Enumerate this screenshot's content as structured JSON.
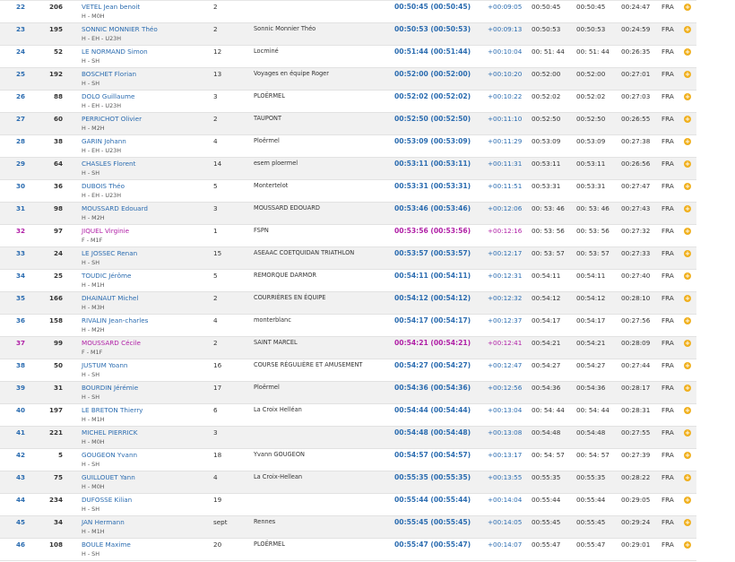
{
  "results": [
    {
      "rank": "22",
      "bib": "206",
      "name": "VETEL Jean benoit",
      "category": "H - M0H",
      "laps": "2",
      "club": "",
      "time": "00:50:45 (00:50:45)",
      "gap": "+00:09:05",
      "t1": "00:50:45",
      "t2": "00:50:45",
      "t3": "00:24:47",
      "nat": "FRA",
      "female": false
    },
    {
      "rank": "23",
      "bib": "195",
      "name": "SONNIC MONNIER Théo",
      "category": "H - EH - U23H",
      "laps": "2",
      "club": "Sonnic Monnier Théo",
      "time": "00:50:53 (00:50:53)",
      "gap": "+00:09:13",
      "t1": "00:50:53",
      "t2": "00:50:53",
      "t3": "00:24:59",
      "nat": "FRA",
      "female": false
    },
    {
      "rank": "24",
      "bib": "52",
      "name": "LE NORMAND Simon",
      "category": "H - SH",
      "laps": "12",
      "club": "Locminé",
      "time": "00:51:44 (00:51:44)",
      "gap": "+00:10:04",
      "t1": "00: 51: 44",
      "t2": "00: 51: 44",
      "t3": "00:26:35",
      "nat": "FRA",
      "female": false
    },
    {
      "rank": "25",
      "bib": "192",
      "name": "BOSCHET Florian",
      "category": "H - SH",
      "laps": "13",
      "club": "Voyages en équipe Roger",
      "time": "00:52:00 (00:52:00)",
      "gap": "+00:10:20",
      "t1": "00:52:00",
      "t2": "00:52:00",
      "t3": "00:27:01",
      "nat": "FRA",
      "female": false
    },
    {
      "rank": "26",
      "bib": "88",
      "name": "DOLO Guillaume",
      "category": "H - EH - U23H",
      "laps": "3",
      "club": "PLOËRMEL",
      "time": "00:52:02 (00:52:02)",
      "gap": "+00:10:22",
      "t1": "00:52:02",
      "t2": "00:52:02",
      "t3": "00:27:03",
      "nat": "FRA",
      "female": false
    },
    {
      "rank": "27",
      "bib": "60",
      "name": "PERRICHOT Olivier",
      "category": "H - M2H",
      "laps": "2",
      "club": "TAUPONT",
      "time": "00:52:50 (00:52:50)",
      "gap": "+00:11:10",
      "t1": "00:52:50",
      "t2": "00:52:50",
      "t3": "00:26:55",
      "nat": "FRA",
      "female": false
    },
    {
      "rank": "28",
      "bib": "38",
      "name": "GARIN Johann",
      "category": "H - EH - U23H",
      "laps": "4",
      "club": "Ploërmel",
      "time": "00:53:09 (00:53:09)",
      "gap": "+00:11:29",
      "t1": "00:53:09",
      "t2": "00:53:09",
      "t3": "00:27:38",
      "nat": "FRA",
      "female": false
    },
    {
      "rank": "29",
      "bib": "64",
      "name": "CHASLES Florent",
      "category": "H - SH",
      "laps": "14",
      "club": "esem ploermel",
      "time": "00:53:11 (00:53:11)",
      "gap": "+00:11:31",
      "t1": "00:53:11",
      "t2": "00:53:11",
      "t3": "00:26:56",
      "nat": "FRA",
      "female": false
    },
    {
      "rank": "30",
      "bib": "36",
      "name": "DUBOIS Théo",
      "category": "H - EH - U23H",
      "laps": "5",
      "club": "Montertelot",
      "time": "00:53:31 (00:53:31)",
      "gap": "+00:11:51",
      "t1": "00:53:31",
      "t2": "00:53:31",
      "t3": "00:27:47",
      "nat": "FRA",
      "female": false
    },
    {
      "rank": "31",
      "bib": "98",
      "name": "MOUSSARD Edouard",
      "category": "H - M2H",
      "laps": "3",
      "club": "MOUSSARD EDOUARD",
      "time": "00:53:46 (00:53:46)",
      "gap": "+00:12:06",
      "t1": "00: 53: 46",
      "t2": "00: 53: 46",
      "t3": "00:27:43",
      "nat": "FRA",
      "female": false
    },
    {
      "rank": "32",
      "bib": "97",
      "name": "JIQUEL Virginie",
      "category": "F - M1F",
      "laps": "1",
      "club": "FSPN",
      "time": "00:53:56 (00:53:56)",
      "gap": "+00:12:16",
      "t1": "00: 53: 56",
      "t2": "00: 53: 56",
      "t3": "00:27:32",
      "nat": "FRA",
      "female": true
    },
    {
      "rank": "33",
      "bib": "24",
      "name": "LE JOSSEC Renan",
      "category": "H - SH",
      "laps": "15",
      "club": "ASEAAC COETQUIDAN TRIATHLON",
      "time": "00:53:57 (00:53:57)",
      "gap": "+00:12:17",
      "t1": "00: 53: 57",
      "t2": "00: 53: 57",
      "t3": "00:27:33",
      "nat": "FRA",
      "female": false
    },
    {
      "rank": "34",
      "bib": "25",
      "name": "TOUDIC Jérôme",
      "category": "H - M1H",
      "laps": "5",
      "club": "REMORQUE DARMOR",
      "time": "00:54:11 (00:54:11)",
      "gap": "+00:12:31",
      "t1": "00:54:11",
      "t2": "00:54:11",
      "t3": "00:27:40",
      "nat": "FRA",
      "female": false
    },
    {
      "rank": "35",
      "bib": "166",
      "name": "DHAINAUT Michel",
      "category": "H - M3H",
      "laps": "2",
      "club": "COURRIÈRES EN ÉQUIPE",
      "time": "00:54:12 (00:54:12)",
      "gap": "+00:12:32",
      "t1": "00:54:12",
      "t2": "00:54:12",
      "t3": "00:28:10",
      "nat": "FRA",
      "female": false
    },
    {
      "rank": "36",
      "bib": "158",
      "name": "RIVALIN Jean-charles",
      "category": "H - M2H",
      "laps": "4",
      "club": "monterblanc",
      "time": "00:54:17 (00:54:17)",
      "gap": "+00:12:37",
      "t1": "00:54:17",
      "t2": "00:54:17",
      "t3": "00:27:56",
      "nat": "FRA",
      "female": false
    },
    {
      "rank": "37",
      "bib": "99",
      "name": "MOUSSARD Cécile",
      "category": "F - M1F",
      "laps": "2",
      "club": "SAINT MARCEL",
      "time": "00:54:21 (00:54:21)",
      "gap": "+00:12:41",
      "t1": "00:54:21",
      "t2": "00:54:21",
      "t3": "00:28:09",
      "nat": "FRA",
      "female": true
    },
    {
      "rank": "38",
      "bib": "50",
      "name": "JUSTUM Yoann",
      "category": "H - SH",
      "laps": "16",
      "club": "COURSE RÉGULIÈRE ET AMUSEMENT",
      "time": "00:54:27 (00:54:27)",
      "gap": "+00:12:47",
      "t1": "00:54:27",
      "t2": "00:54:27",
      "t3": "00:27:44",
      "nat": "FRA",
      "female": false
    },
    {
      "rank": "39",
      "bib": "31",
      "name": "BOURDIN Jérémie",
      "category": "H - SH",
      "laps": "17",
      "club": "Ploërmel",
      "time": "00:54:36 (00:54:36)",
      "gap": "+00:12:56",
      "t1": "00:54:36",
      "t2": "00:54:36",
      "t3": "00:28:17",
      "nat": "FRA",
      "female": false
    },
    {
      "rank": "40",
      "bib": "197",
      "name": "LE BRETON Thierry",
      "category": "H - M1H",
      "laps": "6",
      "club": "La Croix Helléan",
      "time": "00:54:44 (00:54:44)",
      "gap": "+00:13:04",
      "t1": "00: 54: 44",
      "t2": "00: 54: 44",
      "t3": "00:28:31",
      "nat": "FRA",
      "female": false
    },
    {
      "rank": "41",
      "bib": "221",
      "name": "MICHEL PIERRICK",
      "category": "H - M0H",
      "laps": "3",
      "club": "",
      "time": "00:54:48 (00:54:48)",
      "gap": "+00:13:08",
      "t1": "00:54:48",
      "t2": "00:54:48",
      "t3": "00:27:55",
      "nat": "FRA",
      "female": false
    },
    {
      "rank": "42",
      "bib": "5",
      "name": "GOUGEON Yvann",
      "category": "H - SH",
      "laps": "18",
      "club": "Yvann GOUGEON",
      "time": "00:54:57 (00:54:57)",
      "gap": "+00:13:17",
      "t1": "00: 54: 57",
      "t2": "00: 54: 57",
      "t3": "00:27:39",
      "nat": "FRA",
      "female": false
    },
    {
      "rank": "43",
      "bib": "75",
      "name": "GUILLOUET Yann",
      "category": "H - M0H",
      "laps": "4",
      "club": "La Croix-Hellean",
      "time": "00:55:35 (00:55:35)",
      "gap": "+00:13:55",
      "t1": "00:55:35",
      "t2": "00:55:35",
      "t3": "00:28:22",
      "nat": "FRA",
      "female": false
    },
    {
      "rank": "44",
      "bib": "234",
      "name": "DUFOSSE Kilian",
      "category": "H - SH",
      "laps": "19",
      "club": "",
      "time": "00:55:44 (00:55:44)",
      "gap": "+00:14:04",
      "t1": "00:55:44",
      "t2": "00:55:44",
      "t3": "00:29:05",
      "nat": "FRA",
      "female": false
    },
    {
      "rank": "45",
      "bib": "34",
      "name": "JAN Hermann",
      "category": "H - M1H",
      "laps": "sept",
      "club": "Rennes",
      "time": "00:55:45 (00:55:45)",
      "gap": "+00:14:05",
      "t1": "00:55:45",
      "t2": "00:55:45",
      "t3": "00:29:24",
      "nat": "FRA",
      "female": false
    },
    {
      "rank": "46",
      "bib": "108",
      "name": "BOULE Maxime",
      "category": "H - SH",
      "laps": "20",
      "club": "PLOËRMEL",
      "time": "00:55:47 (00:55:47)",
      "gap": "+00:14:07",
      "t1": "00:55:47",
      "t2": "00:55:47",
      "t3": "00:29:01",
      "nat": "FRA",
      "female": false
    }
  ],
  "row_action_icon": "plus-circle-icon",
  "colors": {
    "link_blue": "#2b6cb0",
    "female_magenta": "#b01fa6",
    "action_orange": "#f0b01e",
    "alt_row": "#f1f1f1"
  }
}
